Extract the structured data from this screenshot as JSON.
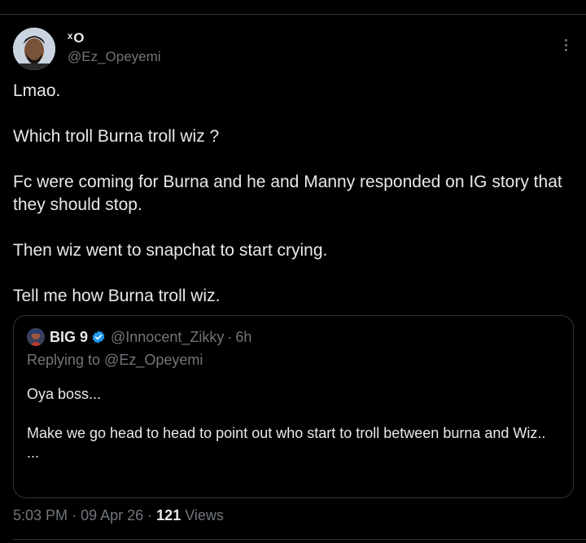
{
  "author": {
    "name": "ˣO",
    "handle": "@Ez_Opeyemi",
    "avatar_icon": "profile-photo"
  },
  "tweet": {
    "paragraphs": [
      "Lmao.",
      "Which troll Burna troll wiz ?",
      "Fc were coming for Burna and he and Manny responded on IG story that they should stop.",
      "Then wiz went to snapchat to start crying.",
      "Tell me how Burna troll wiz."
    ]
  },
  "quoted": {
    "name": "BIG 9",
    "handle": "@Innocent_Zikky",
    "separator": "·",
    "time": "6h",
    "replying_to": "Replying to @Ez_Opeyemi",
    "text_lines": [
      "Oya boss...",
      "Make we go head to head to point out who start to troll between burna and Wiz..",
      "..."
    ],
    "verified_color": "#1d9bf0"
  },
  "meta": {
    "time": "5:03 PM",
    "separator": "·",
    "date": "09 Apr 26",
    "views_count": "121",
    "views_label": "Views"
  },
  "colors": {
    "background": "#000000",
    "text": "#e7e9ea",
    "muted": "#71767b",
    "border": "#2f3336"
  }
}
